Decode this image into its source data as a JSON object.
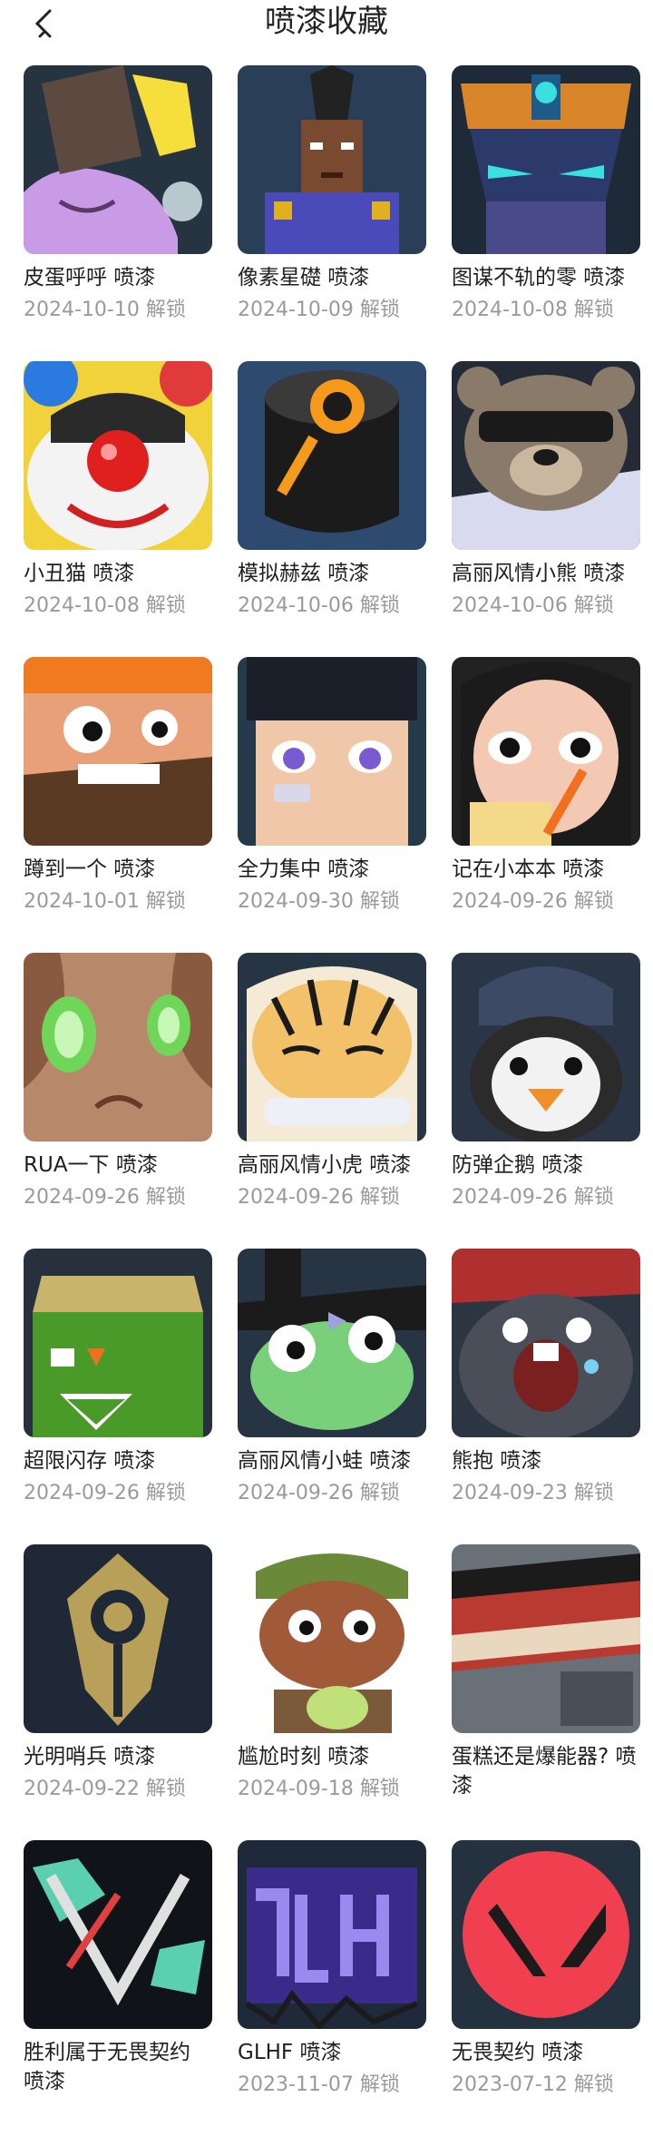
{
  "header": {
    "title": "喷漆收藏",
    "back_icon": "chevron-left-icon"
  },
  "items": [
    {
      "name": "皮蛋呼呼 喷漆",
      "date": "2024-10-10 解锁"
    },
    {
      "name": "像素星礎 喷漆",
      "date": "2024-10-09 解锁"
    },
    {
      "name": "图谋不轨的零 喷漆",
      "date": "2024-10-08 解锁"
    },
    {
      "name": "小丑猫 喷漆",
      "date": "2024-10-08 解锁"
    },
    {
      "name": "模拟赫兹 喷漆",
      "date": "2024-10-06 解锁"
    },
    {
      "name": "高丽风情小熊 喷漆",
      "date": "2024-10-06 解锁"
    },
    {
      "name": "蹲到一个 喷漆",
      "date": "2024-10-01 解锁"
    },
    {
      "name": "全力集中 喷漆",
      "date": "2024-09-30 解锁"
    },
    {
      "name": "记在小本本 喷漆",
      "date": "2024-09-26 解锁"
    },
    {
      "name": "RUA一下 喷漆",
      "date": "2024-09-26 解锁"
    },
    {
      "name": "高丽风情小虎 喷漆",
      "date": "2024-09-26 解锁"
    },
    {
      "name": "防弹企鹅 喷漆",
      "date": "2024-09-26 解锁"
    },
    {
      "name": "超限闪存 喷漆",
      "date": "2024-09-26 解锁"
    },
    {
      "name": "高丽风情小蛙 喷漆",
      "date": "2024-09-26 解锁"
    },
    {
      "name": "熊抱 喷漆",
      "date": "2024-09-23 解锁"
    },
    {
      "name": "光明哨兵 喷漆",
      "date": "2024-09-22 解锁"
    },
    {
      "name": "尴尬时刻 喷漆",
      "date": "2024-09-18 解锁"
    },
    {
      "name": "蛋糕还是爆能器? 喷漆",
      "date": ""
    },
    {
      "name": "胜利属于无畏契约 喷漆",
      "date": ""
    },
    {
      "name": "GLHF 喷漆",
      "date": "2023-11-07 解锁"
    },
    {
      "name": "无畏契约 喷漆",
      "date": "2023-07-12 解锁"
    }
  ]
}
